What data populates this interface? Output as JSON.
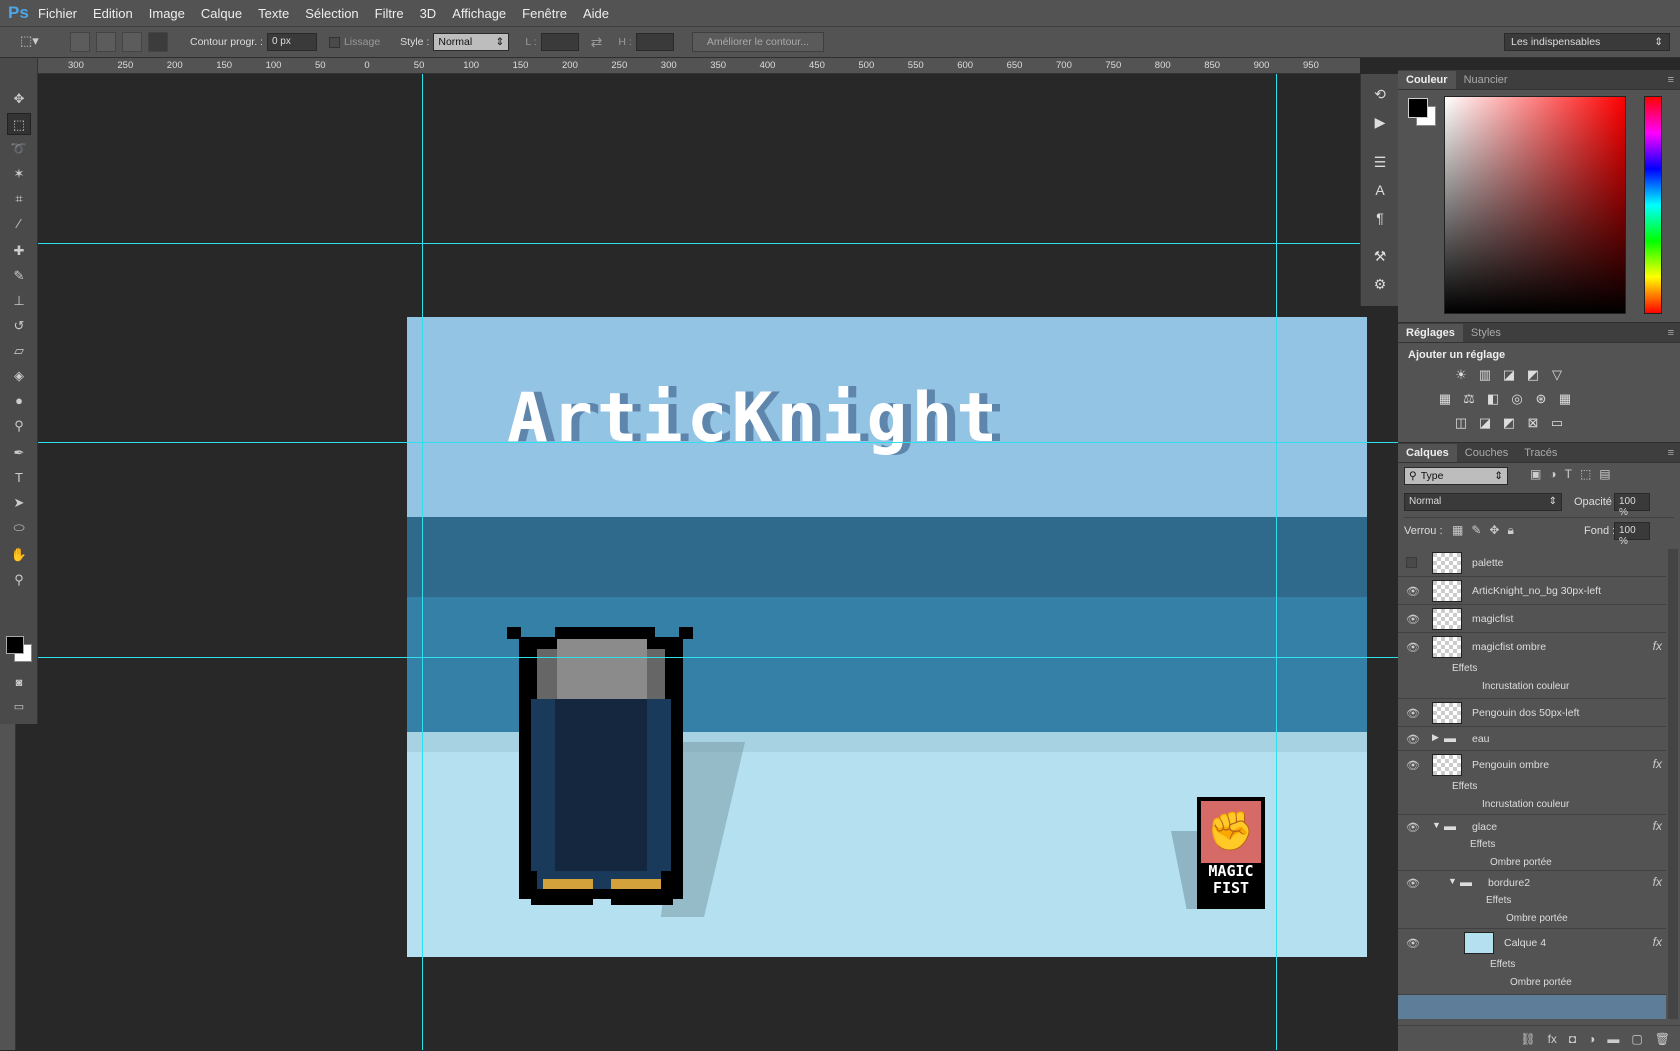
{
  "app": {
    "logo": "Ps"
  },
  "menu": [
    "Fichier",
    "Edition",
    "Image",
    "Calque",
    "Texte",
    "Sélection",
    "Filtre",
    "3D",
    "Affichage",
    "Fenêtre",
    "Aide"
  ],
  "options": {
    "feather_label": "Contour progr. :",
    "feather_value": "0 px",
    "antialias_label": "Lissage",
    "style_label": "Style :",
    "style_value": "Normal",
    "width_label": "L :",
    "height_label": "H :",
    "refine_button": "Améliorer le contour...",
    "workspace": "Les indispensables"
  },
  "ruler_top": [
    "300",
    "250",
    "200",
    "150",
    "100",
    "50",
    "0",
    "50",
    "100",
    "150",
    "200",
    "250",
    "300",
    "350",
    "400",
    "450",
    "500",
    "550",
    "600",
    "650",
    "700",
    "750",
    "800",
    "850",
    "900",
    "950"
  ],
  "document": {
    "title_text": "ArticKnight",
    "logo_line1": "MAGIC",
    "logo_line2": "FIST"
  },
  "color_panel": {
    "tabs": [
      "Couleur",
      "Nuancier"
    ],
    "fg": "#000000",
    "bg": "#ffffff"
  },
  "adjust_panel": {
    "tabs": [
      "Réglages",
      "Styles"
    ],
    "heading": "Ajouter un réglage"
  },
  "layers_panel": {
    "tabs": [
      "Calques",
      "Couches",
      "Tracés"
    ],
    "filter_type": "Type",
    "blend_mode": "Normal",
    "opacity_label": "Opacité :",
    "opacity_value": "100 %",
    "lock_label": "Verrou :",
    "fill_label": "Fond :",
    "fill_value": "100 %",
    "layers": [
      {
        "name": "palette"
      },
      {
        "name": "ArticKnight_no_bg 30px-left"
      },
      {
        "name": "magicfist"
      },
      {
        "name": "magicfist ombre",
        "effects": "Effets",
        "effect": "Incrustation couleur"
      },
      {
        "name": "Pengouin dos 50px-left"
      },
      {
        "name": "eau"
      },
      {
        "name": "Pengouin ombre",
        "effects": "Effets",
        "effect": "Incrustation couleur"
      },
      {
        "name": "glace",
        "effects": "Effets",
        "effect": "Ombre portée"
      },
      {
        "name": "bordure2",
        "effects": "Effets",
        "effect": "Ombre portée"
      },
      {
        "name": "Calque 4",
        "effects": "Effets",
        "effect": "Ombre portée"
      }
    ]
  },
  "colors": {
    "guide": "#2ee0ee",
    "accent": "#4ea6e6"
  }
}
